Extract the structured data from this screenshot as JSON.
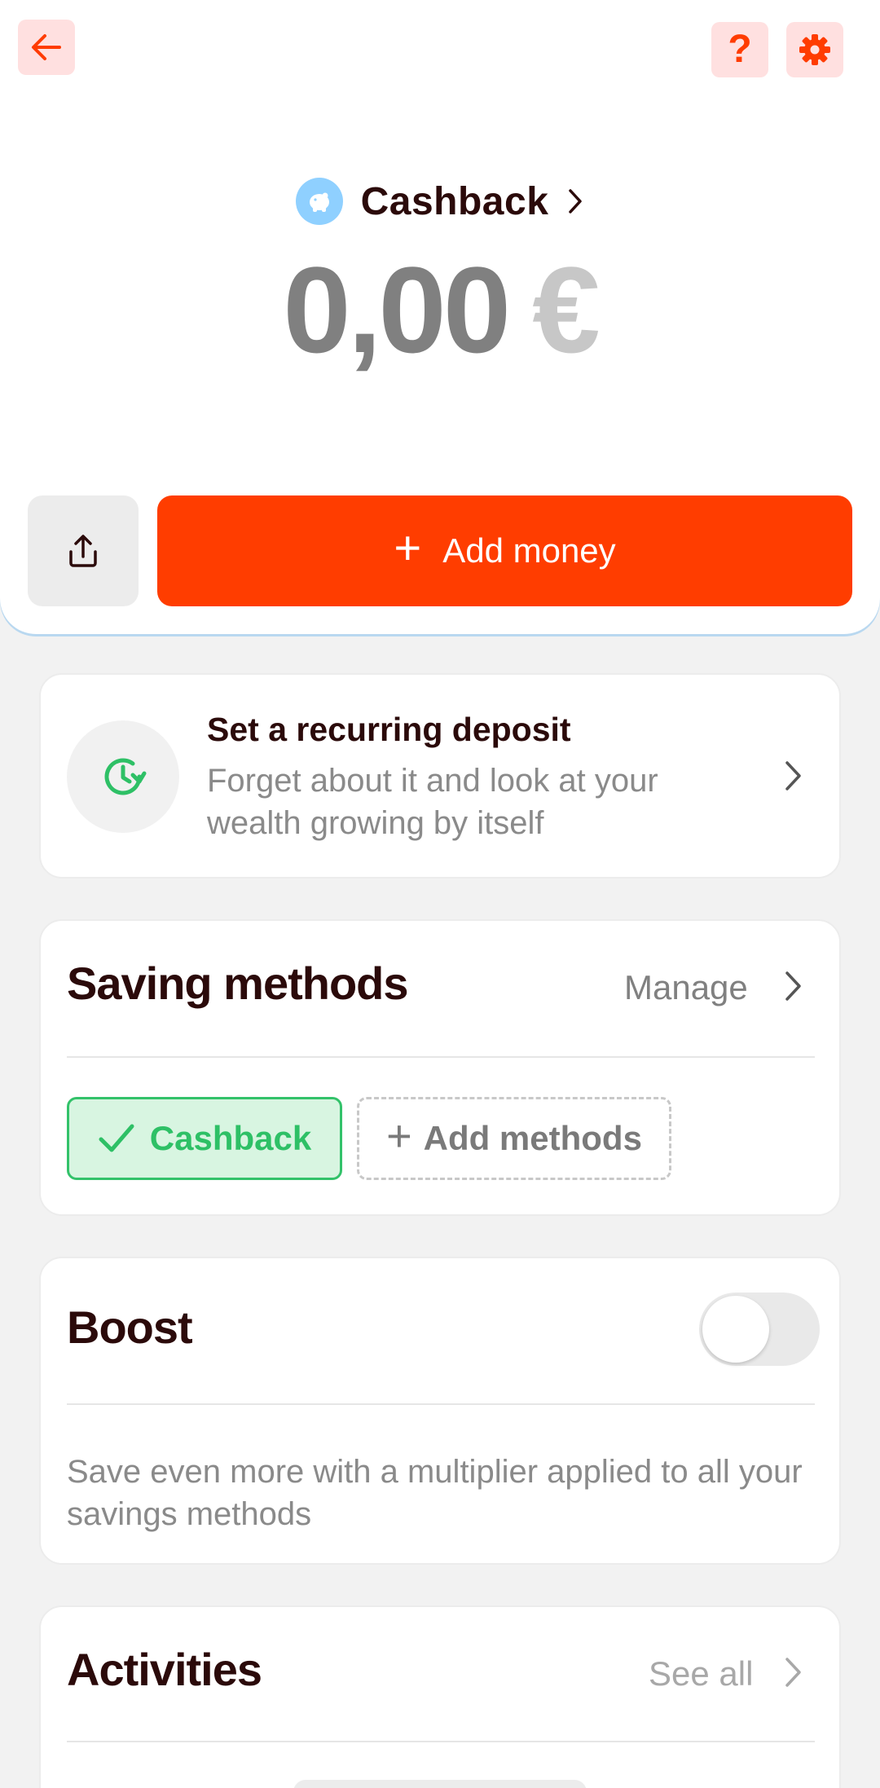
{
  "header": {
    "back_icon": "arrow-left-icon",
    "help_label": "?",
    "settings_icon": "gear-icon",
    "accent": "#ff3d00"
  },
  "account": {
    "icon": "piggy-bank-icon",
    "name": "Cashback",
    "balance_amount": "0,00",
    "balance_currency": "€"
  },
  "actions": {
    "share_icon": "share-icon",
    "add_money_label": "Add money"
  },
  "recurring": {
    "title": "Set a recurring deposit",
    "subtitle": "Forget about it and look at your wealth growing by itself"
  },
  "saving_methods": {
    "title": "Saving methods",
    "manage_label": "Manage",
    "active_method": "Cashback",
    "add_label": "Add methods"
  },
  "boost": {
    "title": "Boost",
    "enabled": false,
    "description": "Save even more with a multiplier applied to all your savings methods"
  },
  "activities": {
    "title": "Activities",
    "see_all_label": "See all"
  }
}
